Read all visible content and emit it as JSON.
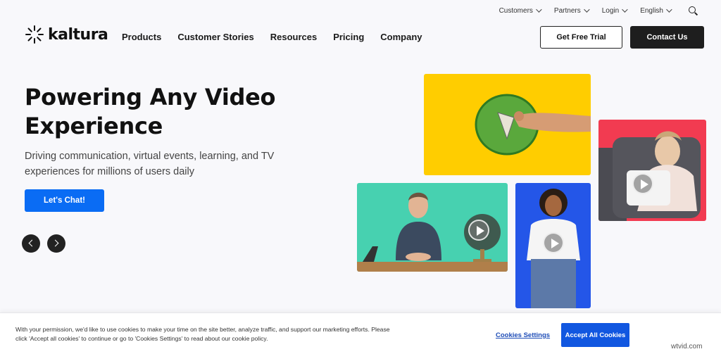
{
  "utility_nav": {
    "items": [
      {
        "label": "Customers"
      },
      {
        "label": "Partners"
      },
      {
        "label": "Login"
      },
      {
        "label": "English"
      }
    ]
  },
  "brand": {
    "name": "kaltura"
  },
  "nav": {
    "links": [
      "Products",
      "Customer Stories",
      "Resources",
      "Pricing",
      "Company"
    ],
    "trial_label": "Get Free Trial",
    "contact_label": "Contact Us"
  },
  "hero": {
    "title_line1": "Powering Any Video",
    "title_line2": "Experience",
    "subtitle": "Driving communication, virtual events, learning, and TV experiences for millions of users daily",
    "cta_label": "Let's Chat!"
  },
  "cookie": {
    "text": "With your permission, we'd like to use cookies to make your time on the site better, analyze traffic, and support our marketing efforts. Please click 'Accept all cookies' to continue or go to 'Cookies Settings' to read about our cookie policy.",
    "settings_label": "Cookies Settings",
    "accept_label": "Accept All Cookies"
  },
  "watermark": "wtvid.com",
  "colors": {
    "primary_blue": "#0a6cf4",
    "dark": "#1e1e1e",
    "tile_yellow": "#ffcd00",
    "tile_red": "#f23b51",
    "tile_green": "#47d1b0",
    "tile_blue": "#2456e8"
  }
}
